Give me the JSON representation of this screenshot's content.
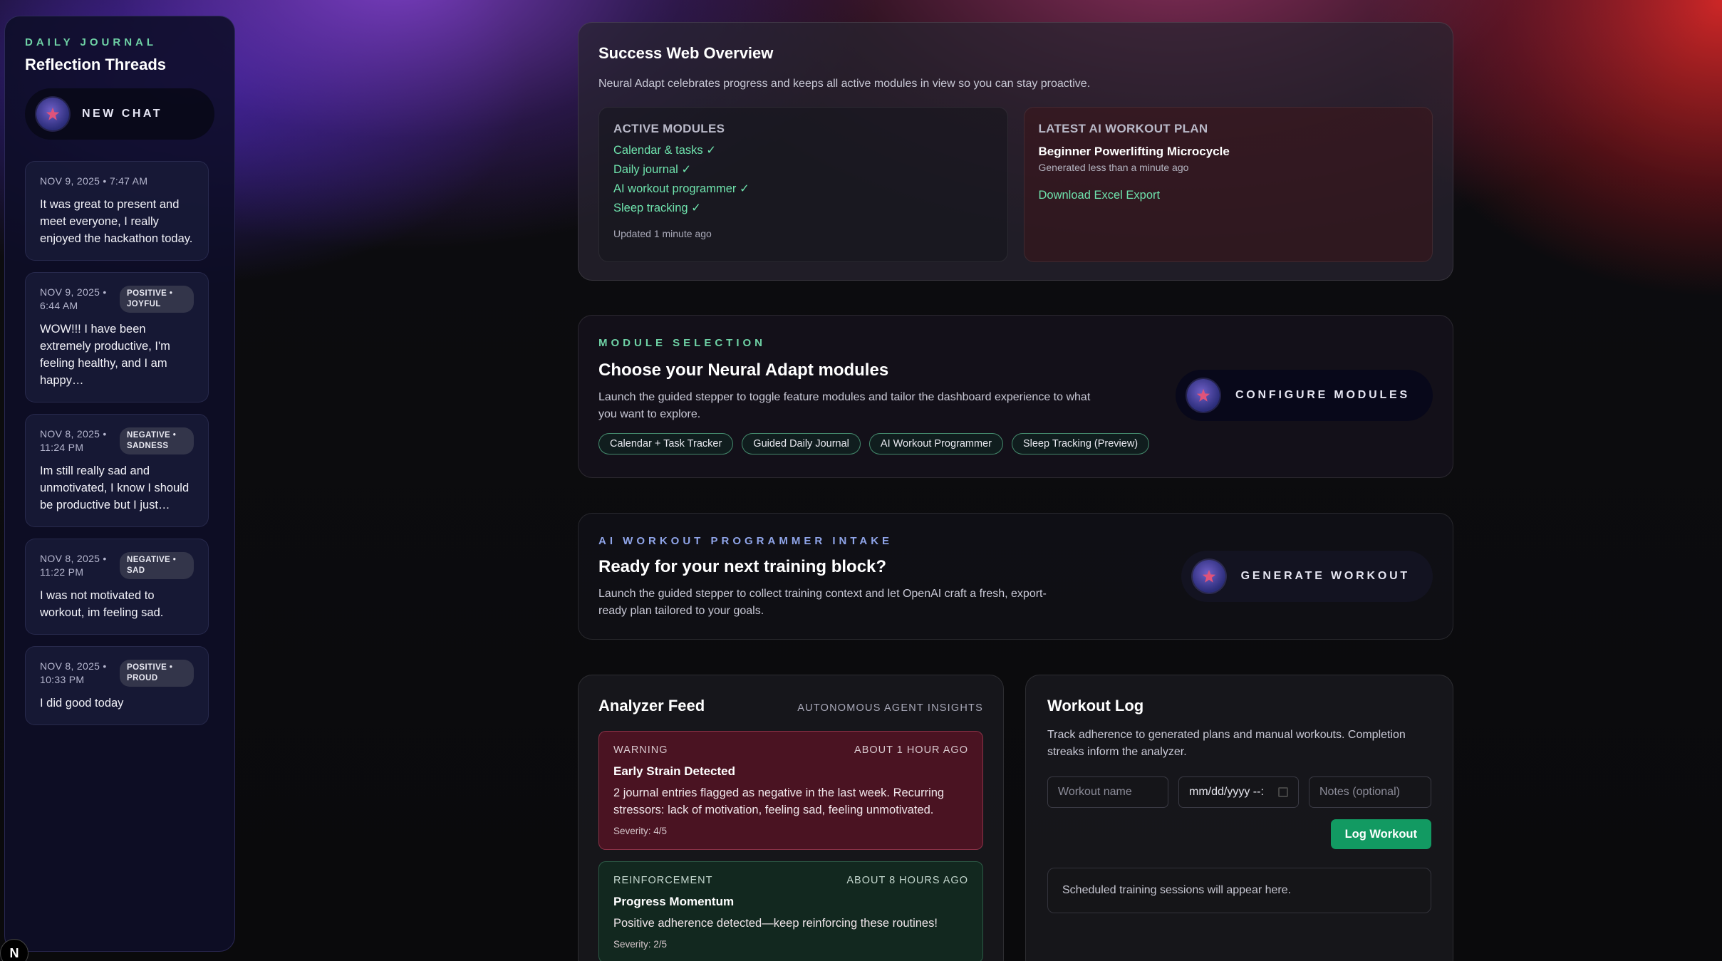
{
  "sidebar": {
    "kicker": "DAILY JOURNAL",
    "title": "Reflection Threads",
    "new_chat_label": "NEW CHAT",
    "entries": [
      {
        "date": "NOV 9, 2025 • 7:47 AM",
        "badge": "",
        "text": "It was great to present and meet everyone, I really enjoyed the hackathon today."
      },
      {
        "date": "NOV 9, 2025 • 6:44 AM",
        "badge": "POSITIVE • JOYFUL",
        "text": "WOW!!! I have been extremely productive, I'm feeling healthy, and I am happy…"
      },
      {
        "date": "NOV 8, 2025 • 11:24 PM",
        "badge": "NEGATIVE • SADNESS",
        "text": "Im still really sad and unmotivated, I know I should be productive but I just…"
      },
      {
        "date": "NOV 8, 2025 • 11:22 PM",
        "badge": "NEGATIVE • SAD",
        "text": "I was not motivated to workout, im feeling sad."
      },
      {
        "date": "NOV 8, 2025 • 10:33 PM",
        "badge": "POSITIVE • PROUD",
        "text": "I did good today"
      }
    ]
  },
  "overview": {
    "title": "Success Web Overview",
    "subtitle": "Neural Adapt celebrates progress and keeps all active modules in view so you can stay proactive.",
    "active_modules": {
      "heading": "ACTIVE MODULES",
      "items": [
        "Calendar & tasks ✓",
        "Daily journal ✓",
        "AI workout programmer ✓",
        "Sleep tracking ✓"
      ],
      "updated": "Updated 1 minute ago"
    },
    "latest_plan": {
      "heading": "LATEST AI WORKOUT PLAN",
      "name": "Beginner Powerlifting Microcycle",
      "generated": "Generated less than a minute ago",
      "link": "Download Excel Export"
    }
  },
  "module_selection": {
    "kicker": "MODULE SELECTION",
    "title": "Choose your Neural Adapt modules",
    "subtitle": "Launch the guided stepper to toggle feature modules and tailor the dashboard experience to what you want to explore.",
    "chips": [
      "Calendar + Task Tracker",
      "Guided Daily Journal",
      "AI Workout Programmer",
      "Sleep Tracking (Preview)"
    ],
    "button_label": "CONFIGURE MODULES"
  },
  "intake": {
    "kicker": "AI WORKOUT PROGRAMMER INTAKE",
    "title": "Ready for your next training block?",
    "subtitle": "Launch the guided stepper to collect training context and let OpenAI craft a fresh, export-ready plan tailored to your goals.",
    "button_label": "GENERATE WORKOUT"
  },
  "analyzer": {
    "title": "Analyzer Feed",
    "right_label": "AUTONOMOUS AGENT INSIGHTS",
    "insights": [
      {
        "type": "WARNING",
        "time": "ABOUT 1 HOUR AGO",
        "title": "Early Strain Detected",
        "body": "2 journal entries flagged as negative in the last week. Recurring stressors: lack of motivation, feeling sad, feeling unmotivated.",
        "severity": "Severity: 4/5"
      },
      {
        "type": "REINFORCEMENT",
        "time": "ABOUT 8 HOURS AGO",
        "title": "Progress Momentum",
        "body": "Positive adherence detected—keep reinforcing these routines!",
        "severity": "Severity: 2/5"
      }
    ]
  },
  "workout_log": {
    "title": "Workout Log",
    "subtitle": "Track adherence to generated plans and manual workouts. Completion streaks inform the analyzer.",
    "name_placeholder": "Workout name",
    "date_value": "mm/dd/yyyy --:",
    "notes_placeholder": "Notes (optional)",
    "button_label": "Log Workout",
    "empty_text": "Scheduled training sessions will appear here."
  },
  "corner_badge": "N",
  "colors": {
    "accent_green": "#6fe3ad",
    "button_green": "#129a62",
    "warning_bg": "#4a1322",
    "reinforcement_bg": "#12281f"
  }
}
